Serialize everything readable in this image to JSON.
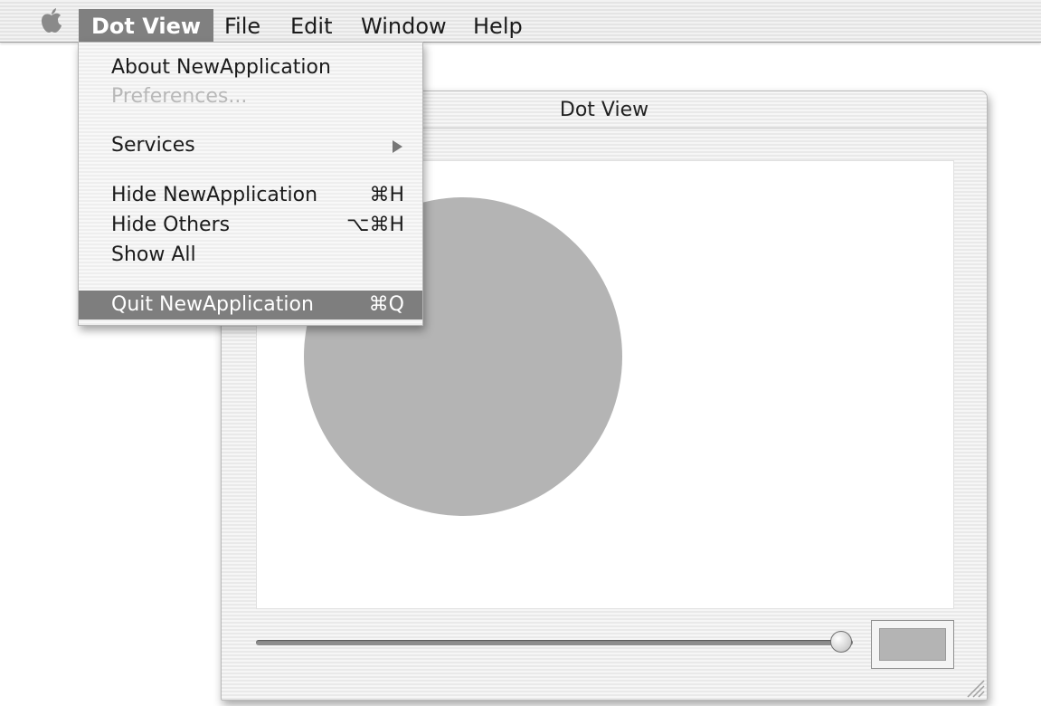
{
  "menubar": {
    "apple_icon": "apple-icon",
    "items": [
      {
        "label": "Dot View",
        "active": true
      },
      {
        "label": "File",
        "active": false
      },
      {
        "label": "Edit",
        "active": false
      },
      {
        "label": "Window",
        "active": false
      },
      {
        "label": "Help",
        "active": false
      }
    ]
  },
  "app_menu": {
    "items": [
      {
        "label": "About NewApplication",
        "shortcut": "",
        "state": "normal"
      },
      {
        "label": "Preferences...",
        "shortcut": "",
        "state": "disabled"
      },
      {
        "label": "Services",
        "shortcut": "",
        "state": "submenu",
        "icon": "chevron-right-icon"
      },
      {
        "label": "Hide NewApplication",
        "shortcut": "⌘H",
        "state": "normal"
      },
      {
        "label": "Hide Others",
        "shortcut": "⌥⌘H",
        "state": "normal"
      },
      {
        "label": "Show All",
        "shortcut": "",
        "state": "normal"
      },
      {
        "label": "Quit NewApplication",
        "shortcut": "⌘Q",
        "state": "selected"
      }
    ]
  },
  "window": {
    "title": "Dot View",
    "dot_color": "#b4b4b4",
    "slider_value_fraction": 0.98,
    "color_well_color": "#b4b4b4"
  },
  "colors": {
    "menu_highlight": "#7e7e7e",
    "canvas_background": "#ffffff"
  }
}
